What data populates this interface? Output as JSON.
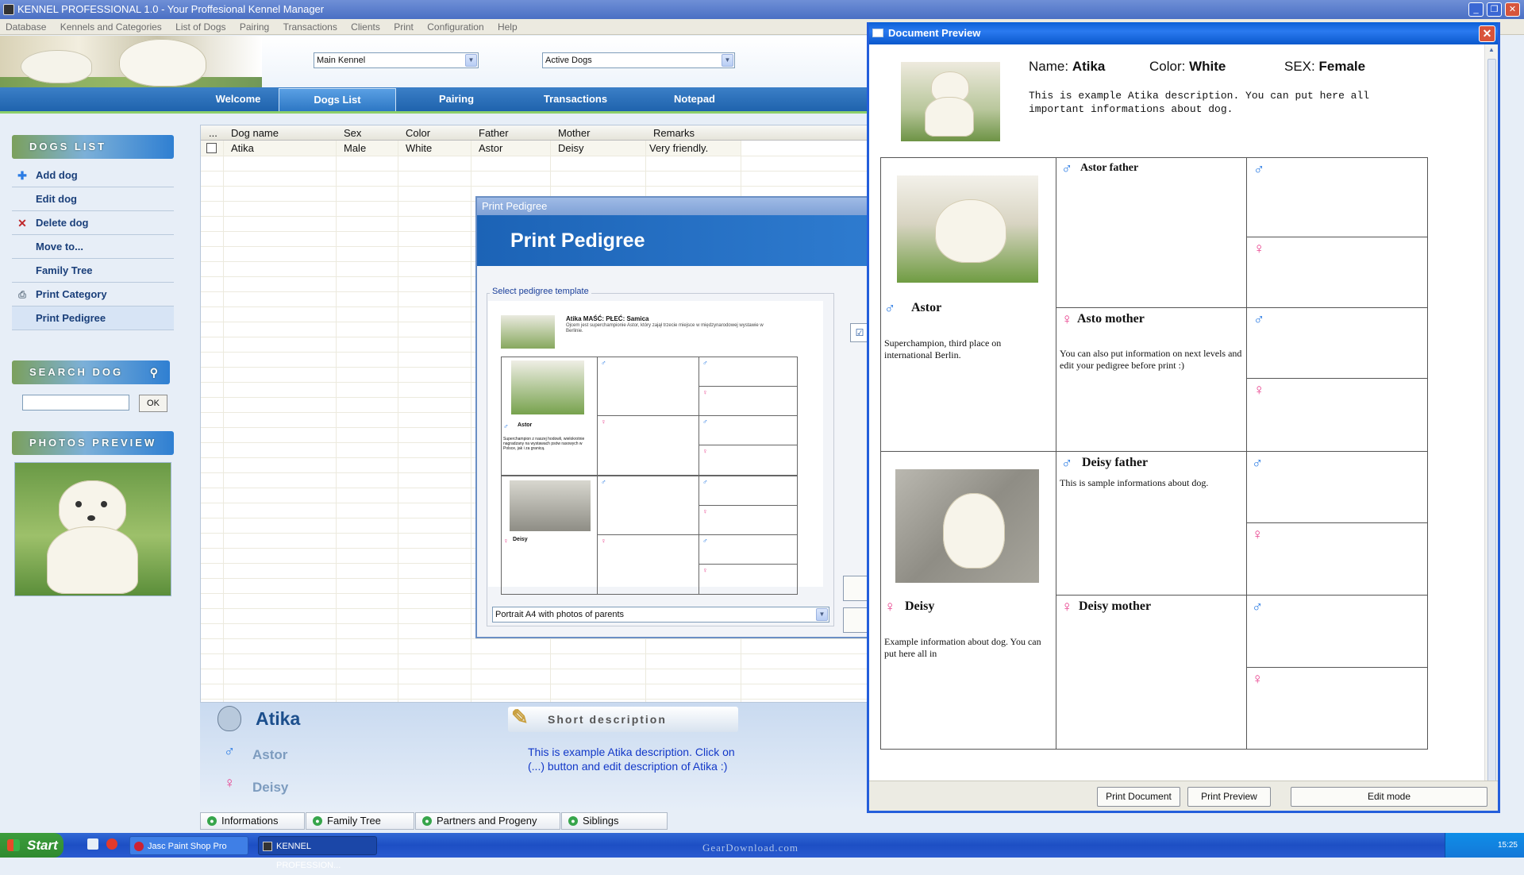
{
  "app": {
    "title": "KENNEL PROFESSIONAL 1.0 - Your Proffesional Kennel Manager"
  },
  "menu": [
    "Database",
    "Kennels and Categories",
    "List of Dogs",
    "Pairing",
    "Transactions",
    "Clients",
    "Print",
    "Configuration",
    "Help"
  ],
  "header": {
    "kennel_combo": "Main Kennel",
    "filter_combo": "Active Dogs"
  },
  "tabs": [
    "Welcome",
    "Dogs List",
    "Pairing",
    "Transactions",
    "Notepad"
  ],
  "sidebar": {
    "dogs_list_title": "DOGS LIST",
    "items": [
      "Add dog",
      "Edit dog",
      "Delete dog",
      "Move to...",
      "Family Tree",
      "Print Category",
      "Print Pedigree"
    ],
    "search_title": "SEARCH DOG",
    "search_ok": "OK",
    "photos_title": "PHOTOS PREVIEW"
  },
  "grid": {
    "columns": [
      "...",
      "Dog name",
      "Sex",
      "Color",
      "Father",
      "Mother",
      "Remarks"
    ],
    "rows": [
      {
        "name": "Atika",
        "sex": "Male",
        "color": "White",
        "father": "Astor",
        "mother": "Deisy",
        "remarks": "Very friendly."
      }
    ]
  },
  "info": {
    "name": "Atika",
    "father": "Astor",
    "mother": "Deisy",
    "short_desc_title": "Short description",
    "description": "This is example Atika description. Click on (...) button and edit description of Atika :)"
  },
  "bottom_tabs": [
    "Informations",
    "Family Tree",
    "Partners and Progeny",
    "Siblings"
  ],
  "print_pedigree": {
    "caption": "Print Pedigree",
    "banner": "Print Pedigree",
    "group_label": "Select pedigree template",
    "mini_header": "Atika MAŚĆ: PŁEĆ: Samica",
    "mini_desc": "Ojcem jest superchampionie Astor, który zajął trzecie miejsce w międzynarodowej wystawie w Berlinie.",
    "mini_father": "Astor",
    "mini_father_desc": "Superchampion z naszej hodowli, wielokrotnie nagradzany na wystawach psów rasowych w Polsce, jak i za granicą.",
    "mini_mother": "Deisy",
    "template_select": "Portrait A4 with photos of parents"
  },
  "doc_preview": {
    "caption": "Document Preview",
    "name_label": "Name:",
    "name_value": "Atika",
    "color_label": "Color:",
    "color_value": "White",
    "sex_label": "SEX:",
    "sex_value": "Female",
    "description": "This is example Atika description. You can put here all important informations about dog.",
    "father_name": "Astor",
    "father_desc": "Superchampion, third place on international Berlin.",
    "mother_name": "Deisy",
    "mother_desc": "Example information about dog. You can put here all in",
    "ff": "Astor father",
    "fm": "Asto mother",
    "fm_desc": "You can also put information on next levels and edit your pedigree before print :)",
    "mf": "Deisy father",
    "mf_desc": "This is sample informations about dog.",
    "mm": "Deisy mother",
    "buttons": [
      "Print Document",
      "Print Preview",
      "Edit mode"
    ]
  },
  "taskbar": {
    "start": "Start",
    "tasks": [
      "Jasc Paint Shop Pro",
      "KENNEL PROFESSION..."
    ],
    "clock": "15:25",
    "watermark": "GearDownload.com"
  },
  "colors": {
    "male": "#2a7be4",
    "female": "#e83f8c",
    "accent": "#2d77c4"
  }
}
